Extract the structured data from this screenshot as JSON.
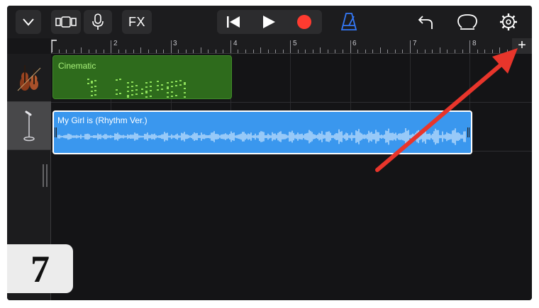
{
  "toolbar": {
    "fx_label": "FX",
    "icons": [
      "chevron-down-icon",
      "tracks-view-icon",
      "microphone-icon",
      "rewind-icon",
      "play-icon",
      "record-icon",
      "metronome-icon",
      "undo-icon",
      "loop-icon",
      "settings-icon"
    ],
    "record_color": "#ff3b30",
    "metronome_color": "#3478f6"
  },
  "ruler": {
    "bars": [
      "2",
      "3",
      "4",
      "5",
      "6",
      "7",
      "8"
    ],
    "add_label": "+"
  },
  "tracks": [
    {
      "instrument_icon": "strings-icon",
      "region_label": "Cinematic",
      "region_color": "#2e6b1c"
    },
    {
      "instrument_icon": "microphone-stand-icon",
      "region_label": "My Girl is (Rhythm Ver.)",
      "region_color": "#3a97ee"
    }
  ],
  "annotation": {
    "step_number": "7",
    "arrow_color": "#e8352b"
  }
}
